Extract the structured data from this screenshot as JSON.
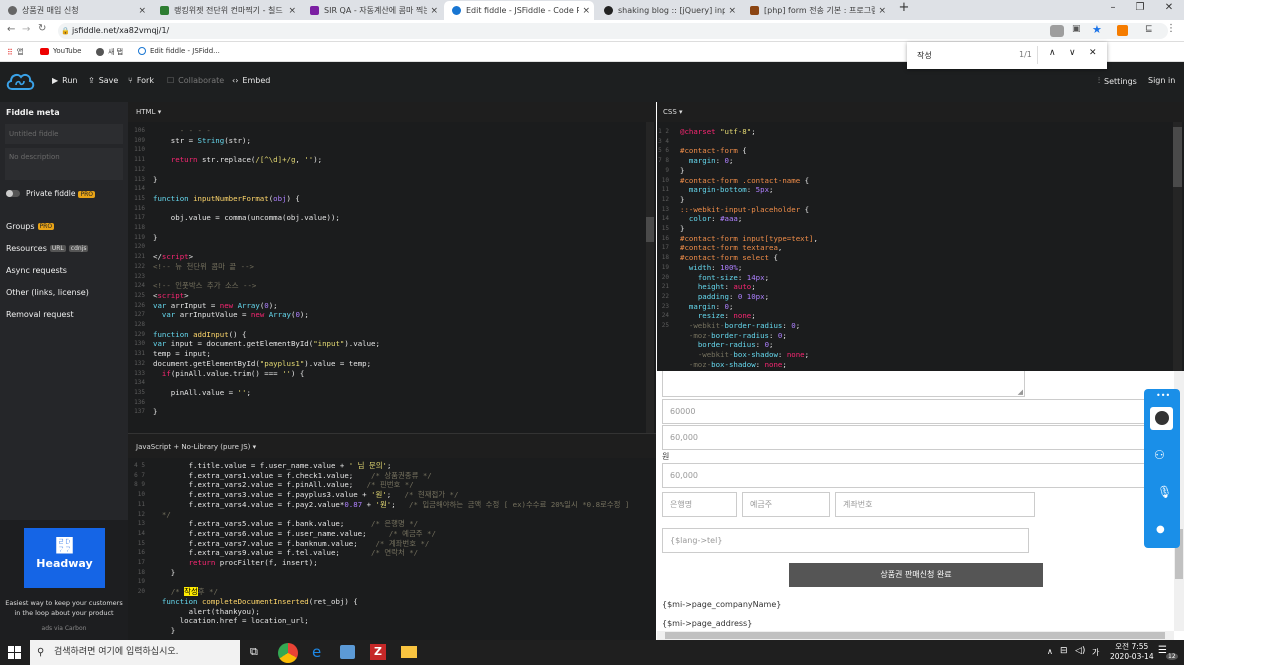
{
  "browser": {
    "tabs": [
      {
        "title": "상품권 매입 신청",
        "icon_color": "#555555"
      },
      {
        "title": "랭킹위젯 전단위 컨마찍기 - 칠드",
        "icon_color": "#2e7d32"
      },
      {
        "title": "SIR QA - 자동계산에 콤마 찍는",
        "icon_color": "#7b1fa2"
      },
      {
        "title": "Edit fiddle - JSFiddle - Code Pl.",
        "icon_color": "#1976d2"
      },
      {
        "title": "shaking blog :: [jQuery] input박",
        "icon_color": "#222222"
      },
      {
        "title": "[php] form 전송 기본 : 프로그램",
        "icon_color": "#8b4513"
      }
    ],
    "url": "jsfiddle.net/xa82vmqj/1/",
    "bookmarks": [
      "앱",
      "YouTube",
      "새 탭",
      "Edit fiddle - JSFidd..."
    ],
    "find": {
      "query": "작성",
      "count": "1/1"
    }
  },
  "header": {
    "run": "Run",
    "save": "Save",
    "fork": "Fork",
    "collaborate": "Collaborate",
    "embed": "Embed",
    "settings": "Settings",
    "signin": "Sign in"
  },
  "sidebar": {
    "title": "Fiddle meta",
    "fiddle_title_placeholder": "Untitled fiddle",
    "description_placeholder": "No description",
    "private": "Private fiddle",
    "pro": "PRO",
    "groups": "Groups",
    "resources": "Resources",
    "url_badge": "URL",
    "cdnjs_badge": "cdnjs",
    "async": "Async requests",
    "other": "Other (links, license)",
    "removal": "Removal request",
    "ad_brand": "Headway",
    "ad_text": "Easiest way to keep your customers in the loop about your product",
    "ad_via": "ads via Carbon"
  },
  "panels": {
    "html_label": "HTML ▾",
    "css_label": "CSS ▾",
    "js_label": "JavaScript + No-Library (pure JS) ▾"
  },
  "result": {
    "v1": "60000",
    "v2": "60,000",
    "won": "원",
    "v3": "60,000",
    "bank_ph": "은행명",
    "holder_ph": "예금주",
    "account_ph": "계좌번호",
    "tel_ph": "{$lang->tel}",
    "submit": "상품권 판매신청 완료",
    "company": "{$mi->page_companyName}",
    "address": "{$mi->page_address}"
  },
  "taskbar": {
    "search": "검색하려면 여기에 입력하십시오.",
    "time": "오전 7:55",
    "date": "2020-03-14",
    "ime": "가",
    "notif": "12"
  }
}
